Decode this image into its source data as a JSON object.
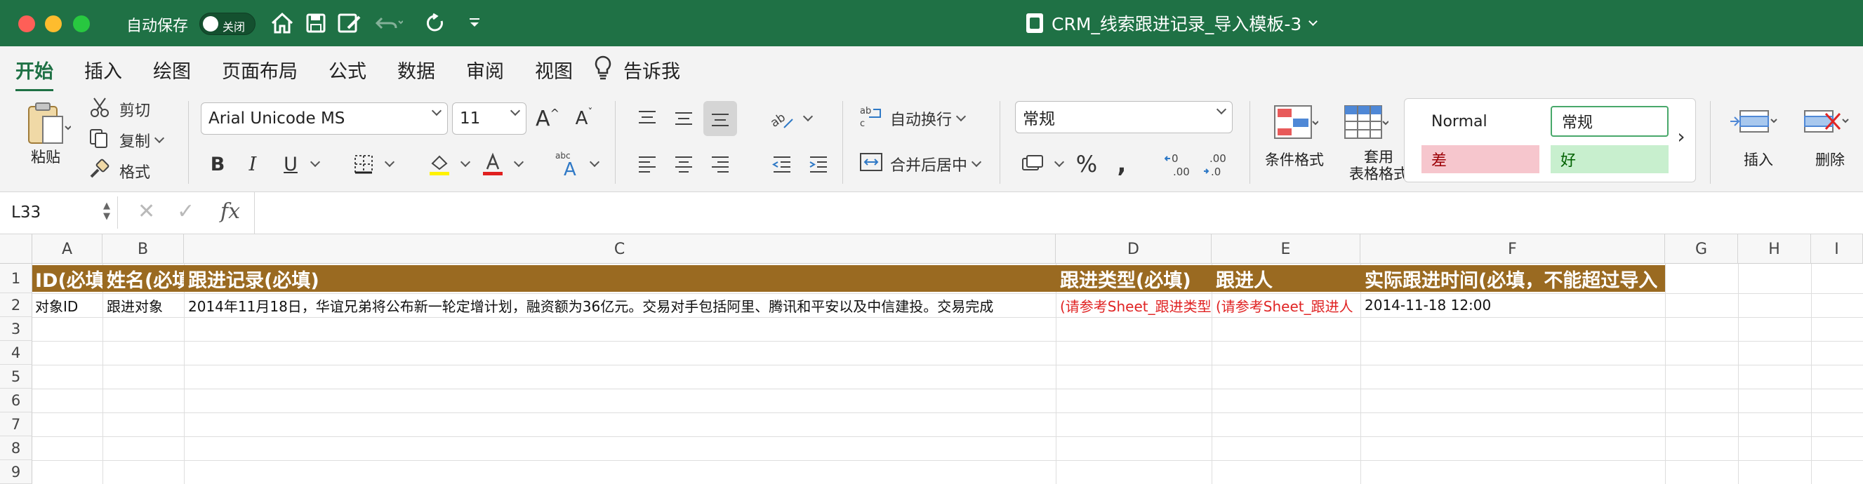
{
  "titlebar": {
    "autosave_label": "自动保存",
    "autosave_state": "关闭",
    "doc_title": "CRM_线索跟进记录_导入模板-3",
    "quick_access_icons": [
      "home-icon",
      "save-icon",
      "edit-save-icon",
      "undo-icon",
      "redo-icon",
      "customize-icon"
    ]
  },
  "tabs": [
    "开始",
    "插入",
    "绘图",
    "页面布局",
    "公式",
    "数据",
    "审阅",
    "视图",
    "告诉我"
  ],
  "ribbon": {
    "paste": "粘贴",
    "cut": "剪切",
    "copy": "复制",
    "format_painter": "格式",
    "font_name": "Arial Unicode MS",
    "font_size": "11",
    "wrap_text": "自动换行",
    "merge_center": "合并后居中",
    "number_format": "常规",
    "conditional_format": "条件格式",
    "table_format": "套用\n表格格式",
    "styles": {
      "normal": "Normal",
      "general": "常规",
      "bad": "差",
      "good": "好"
    },
    "insert": "插入",
    "delete": "删除"
  },
  "formula_bar": {
    "name_box": "L33",
    "formula": ""
  },
  "columns": [
    "A",
    "B",
    "C",
    "D",
    "E",
    "F",
    "G",
    "H",
    "I"
  ],
  "rows": [
    "1",
    "2",
    "3",
    "4",
    "5",
    "6",
    "7",
    "8",
    "9"
  ],
  "sheet": {
    "row1": [
      "ID(必填",
      "姓名(必填",
      "跟进记录(必填)",
      "跟进类型(必填)",
      "跟进人",
      "实际跟进时间(必填，不能超过导入"
    ],
    "row2": [
      "对象ID",
      "跟进对象",
      "2014年11月18日，华谊兄弟将公布新一轮定增计划，融资额为36亿元。交易对手包括阿里、腾讯和平安以及中信建投。交易完成",
      "(请参考Sheet_跟进类型",
      "(请参考Sheet_跟进人",
      "2014-11-18 12:00"
    ]
  },
  "colors": {
    "titlebar": "#1f7145",
    "header_band": "#9a6a21",
    "hint_red": "#e02424",
    "bad_fill": "#f6c6cd",
    "good_fill": "#c8efce"
  }
}
